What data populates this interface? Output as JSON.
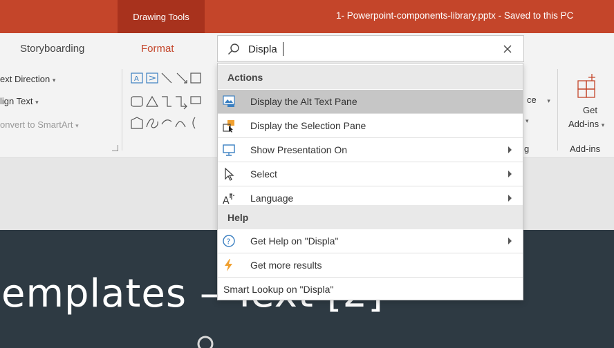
{
  "title_bar": {
    "contextual_tab": "Drawing Tools",
    "document_title": "1- Powerpoint-components-library.pptx  -  Saved to this PC",
    "accent_color": "#c4452a"
  },
  "tabs": {
    "storyboarding": "Storyboarding",
    "format": "Format"
  },
  "ribbon": {
    "text_direction": "ext Direction",
    "align_text": "lign Text",
    "convert_smartart": "onvert to SmartArt",
    "partial_ce": "ce",
    "partial_g": "g",
    "get_addins_line1": "Get",
    "get_addins_line2": "Add-ins",
    "addins_group": "Add-ins"
  },
  "search": {
    "query": "Displa",
    "icon": "search-icon",
    "close_icon": "close-icon"
  },
  "dropdown": {
    "actions_header": "Actions",
    "actions": [
      {
        "label": "Display the Alt Text Pane",
        "icon": "alt-text-pane-icon",
        "submenu": false,
        "highlighted": true
      },
      {
        "label": "Display the Selection Pane",
        "icon": "selection-pane-icon",
        "submenu": false,
        "highlighted": false
      },
      {
        "label": "Show Presentation On",
        "icon": "monitor-icon",
        "submenu": true,
        "highlighted": false
      },
      {
        "label": "Select",
        "icon": "cursor-icon",
        "submenu": true,
        "highlighted": false
      },
      {
        "label": "Language",
        "icon": "language-icon",
        "submenu": true,
        "highlighted": false
      }
    ],
    "help_header": "Help",
    "help": [
      {
        "label": "Get Help on \"Displa\"",
        "icon": "help-icon",
        "submenu": true
      },
      {
        "label": "Get more results",
        "icon": "lightning-icon",
        "submenu": false
      }
    ],
    "smart_lookup": "Smart Lookup on \"Displa\""
  },
  "slide": {
    "title_fragment": "emplates – Text [2]"
  }
}
